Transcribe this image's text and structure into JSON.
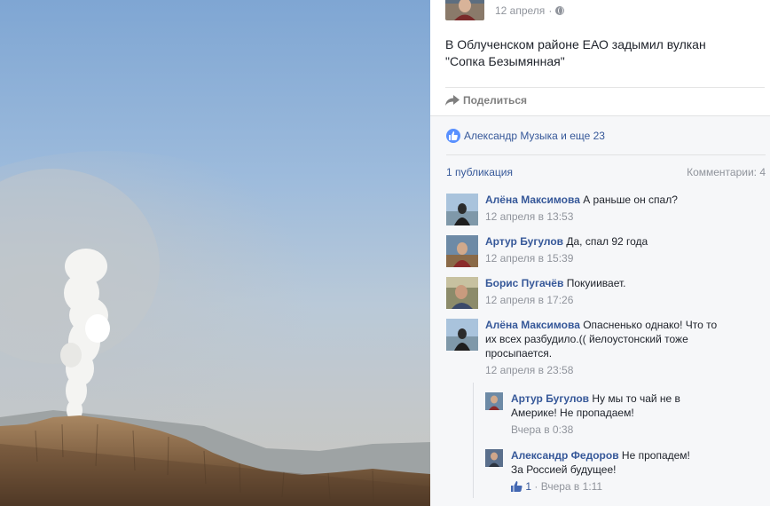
{
  "post": {
    "date": "12 апреля",
    "dot": "·",
    "privacy_icon": "globe-icon",
    "text_line1": "В Облученском районе ЕАО задымил вулкан",
    "text_line2": "\"Сопка Безымянная\""
  },
  "share": {
    "label": "Поделиться",
    "icon": "share-arrow-icon"
  },
  "likes": {
    "icon": "thumbs-up-icon",
    "text": "Александр Музыка и еще 23"
  },
  "stats": {
    "publications": "1 публикация",
    "comments": "Комментарии: 4"
  },
  "comments": [
    {
      "author": "Алёна Максимова",
      "text": "А раньше он спал?",
      "time": "12 апреля в 13:53"
    },
    {
      "author": "Артур Бугулов",
      "text": "Да, спал 92 года",
      "time": "12 апреля в 15:39"
    },
    {
      "author": "Борис Пугачёв",
      "text": "Покуиивает.",
      "time": "12 апреля в 17:26"
    },
    {
      "author": "Алёна Максимова",
      "text_line1": "Опасненько однако! Что то",
      "text_line2": "их всех разбудило.(( йелоустонский тоже",
      "text_line3": "просыпается.",
      "time": "12 апреля в 23:58"
    }
  ],
  "replies": [
    {
      "author": "Артур Бугулов",
      "text_line1": "Ну мы то чай не в",
      "text_line2": "Америке! Не пропадаем!",
      "time": "Вчера в 0:38"
    },
    {
      "author": "Александр Федоров",
      "text_line1": "Не пропадем!",
      "text_line2": "За Россией будущее!",
      "like_count": "1",
      "like_sep": "·",
      "time": "Вчера в 1:11"
    }
  ],
  "colors": {
    "link": "#365899",
    "meta": "#90949c",
    "like_blue": "#5890ff",
    "ufi_bg": "#f6f7f9"
  }
}
